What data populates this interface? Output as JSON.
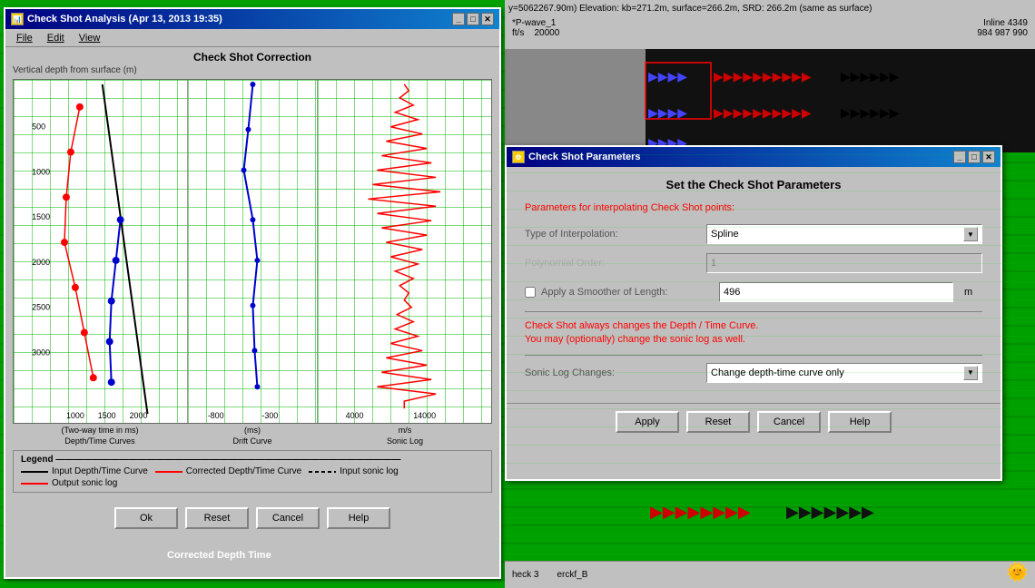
{
  "top_info": {
    "text": "y=5062267.90m) Elevation: kb=271.2m, surface=266.2m, SRD: 266.2m (same as surface)"
  },
  "seismic_header": {
    "left_label": "*P-wave_1",
    "left_units": "ft/s",
    "left_value": "20000",
    "right_label": "Inline 4349",
    "right_values": "984  987  990"
  },
  "check_shot_window": {
    "title": "Check Shot Analysis  (Apr 13, 2013  19:35)",
    "menu": [
      "File",
      "Edit",
      "View"
    ],
    "chart_title": "Check Shot Correction",
    "y_axis_title": "Vertical depth from surface (m)",
    "y_labels": [
      "500",
      "1000",
      "1500",
      "2000",
      "2500",
      "3000"
    ],
    "chart1": {
      "title": "Depth/Time Curves",
      "x_labels": [
        "1000",
        "1500",
        "2000"
      ],
      "x_unit": "(Two-way time in ms)"
    },
    "chart2": {
      "title": "Drift Curve",
      "x_labels": [
        "-800",
        "-300"
      ],
      "x_unit": "(ms)"
    },
    "chart3": {
      "title": "Sonic Log",
      "x_labels": [
        "4000",
        "14000"
      ],
      "x_unit": "m/s"
    },
    "legend": {
      "title": "Legend",
      "items": [
        {
          "label": "Input Depth/Time Curve",
          "color": "#000000",
          "style": "solid"
        },
        {
          "label": "Corrected Depth/Time Curve",
          "color": "#ff0000",
          "style": "solid"
        },
        {
          "label": "Input sonic log",
          "color": "#000000",
          "style": "dashed"
        },
        {
          "label": "Output sonic log",
          "color": "#ff0000",
          "style": "solid"
        }
      ]
    },
    "buttons": {
      "ok": "Ok",
      "reset": "Reset",
      "cancel": "Cancel",
      "help": "Help"
    }
  },
  "params_dialog": {
    "title": "Check Shot Parameters",
    "main_title": "Set the Check Shot Parameters",
    "subtitle": "Parameters for interpolating Check Shot points:",
    "interpolation_label": "Type of Interpolation:",
    "interpolation_value": "Spline",
    "polynomial_label": "Polynomial Order:",
    "polynomial_value": "1",
    "smoother_label": "Apply a Smoother of Length:",
    "smoother_value": "496",
    "smoother_unit": "m",
    "smoother_checked": false,
    "info_line1": "Check Shot always changes the Depth / Time Curve.",
    "info_line2": "You may (optionally) change the sonic log as well.",
    "sonic_label": "Sonic Log Changes:",
    "sonic_value": "Change depth-time curve only",
    "buttons": {
      "apply": "Apply",
      "reset": "Reset",
      "cancel": "Cancel",
      "help": "Help"
    }
  },
  "bottom_bar": {
    "left_text": "heck 3",
    "right_text": "erckf_B"
  },
  "corrected_label": "Corrected Depth Time"
}
